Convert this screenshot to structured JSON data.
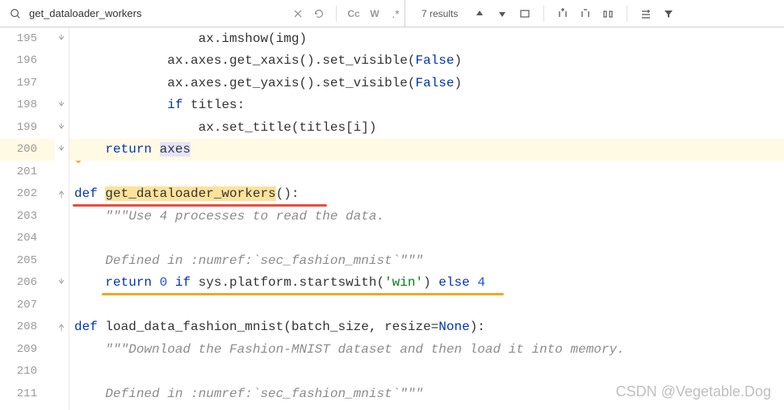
{
  "search": {
    "query": "get_dataloader_workers",
    "results_text": "7 results",
    "cc_label": "Cc",
    "w_label": "W"
  },
  "gutter": {
    "start": 195,
    "end": 211,
    "highlighted": 200
  },
  "code": {
    "l195": {
      "indent": "                ",
      "t1": "ax.imshow(img)"
    },
    "l196": {
      "indent": "            ",
      "t1": "ax.axes.get_xaxis().set_visible(",
      "bool": "False",
      "t2": ")"
    },
    "l197": {
      "indent": "            ",
      "t1": "ax.axes.get_yaxis().set_visible(",
      "bool": "False",
      "t2": ")"
    },
    "l198": {
      "indent": "            ",
      "kw": "if ",
      "t1": "titles:"
    },
    "l199": {
      "indent": "                ",
      "t1": "ax.set_title(titles[i])"
    },
    "l200": {
      "indent": "    ",
      "kw": "return ",
      "ident": "axes"
    },
    "l202": {
      "kw": "def ",
      "fn": "get_dataloader_workers",
      "t1": "():"
    },
    "l203": {
      "indent": "    ",
      "doc": "\"\"\"Use 4 processes to read the data."
    },
    "l205": {
      "indent": "    ",
      "doc": "Defined in :numref:`sec_fashion_mnist`\"\"\""
    },
    "l206": {
      "indent": "    ",
      "kw1": "return ",
      "n1": "0",
      " kw2": " if ",
      "t1": "sys.platform.startswith(",
      "str": "'win'",
      "t2": ")",
      "kw3": " else ",
      "n2": "4"
    },
    "l208": {
      "kw": "def ",
      "fn": "load_data_fashion_mnist",
      "t1": "(batch_size, resize=",
      "none": "None",
      "t2": "):"
    },
    "l209": {
      "indent": "    ",
      "doc": "\"\"\"Download the Fashion-MNIST dataset and then load it into memory."
    },
    "l211": {
      "indent": "    ",
      "doc": "Defined in :numref:`sec_fashion_mnist`\"\"\""
    }
  },
  "watermark": "CSDN @Vegetable.Dog"
}
